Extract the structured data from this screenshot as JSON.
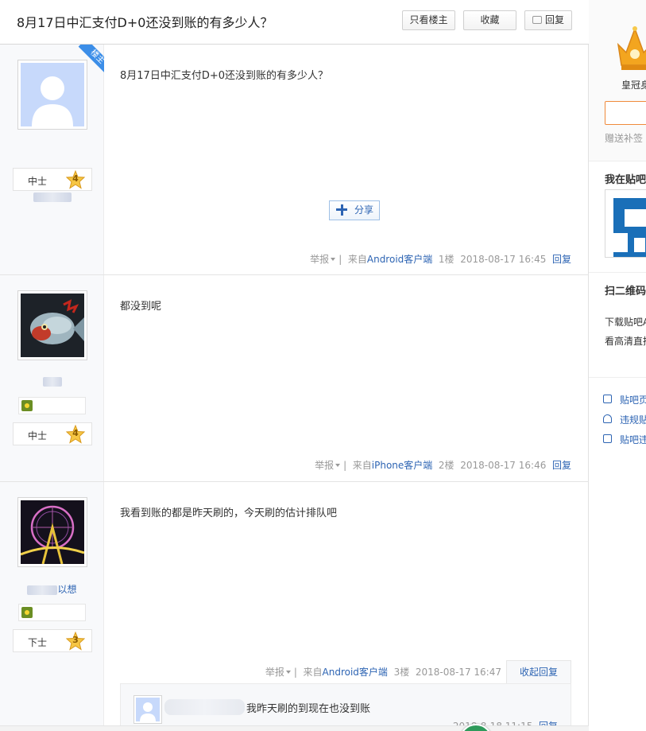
{
  "thread": {
    "title": "8月17日中汇支付D+0还没到账的有多少人？",
    "buttons": {
      "only_op": "只看楼主",
      "favorite": "收藏",
      "reply": "回复"
    }
  },
  "labels": {
    "op_badge": "楼主",
    "share": "分享",
    "report": "举报",
    "reply": "回复",
    "fold_replies": "收起回复"
  },
  "posts": [
    {
      "content": "8月17日中汇支付D+0还没到账的有多少人？",
      "level_name": "中士",
      "level_num": "4",
      "source": "来自Android客户端",
      "floor": "1楼",
      "time": "2018-08-17 16:45"
    },
    {
      "content": "都没到呢",
      "level_name": "中士",
      "level_num": "4",
      "source": "来自iPhone客户端",
      "floor": "2楼",
      "time": "2018-08-17 16:46"
    },
    {
      "content": "我看到账的都是昨天刷的，今天刷的估计排队吧",
      "username_suffix": "以想",
      "level_name": "下士",
      "level_num": "3",
      "source": "来自Android客户端",
      "floor": "3楼",
      "time": "2018-08-17 16:47",
      "sub_reply": {
        "text": "我昨天刷的到现在也没到账",
        "time": "2018-8-18 11:15",
        "reply": "回复"
      }
    }
  ],
  "sidebar": {
    "crown_label": "皇冠身",
    "sign_text": "赠送补签",
    "my_bar": "我在贴吧",
    "qr_title": "扫二维码",
    "qr_line1": "下载贴吧A",
    "qr_line2": "看高清直播",
    "links": [
      "贴吧页",
      "违规贴",
      "贴吧违"
    ]
  },
  "colors": {
    "link": "#2d64b3",
    "accent_orange": "#f08a3b",
    "badge_blue": "#3c8ee8"
  }
}
